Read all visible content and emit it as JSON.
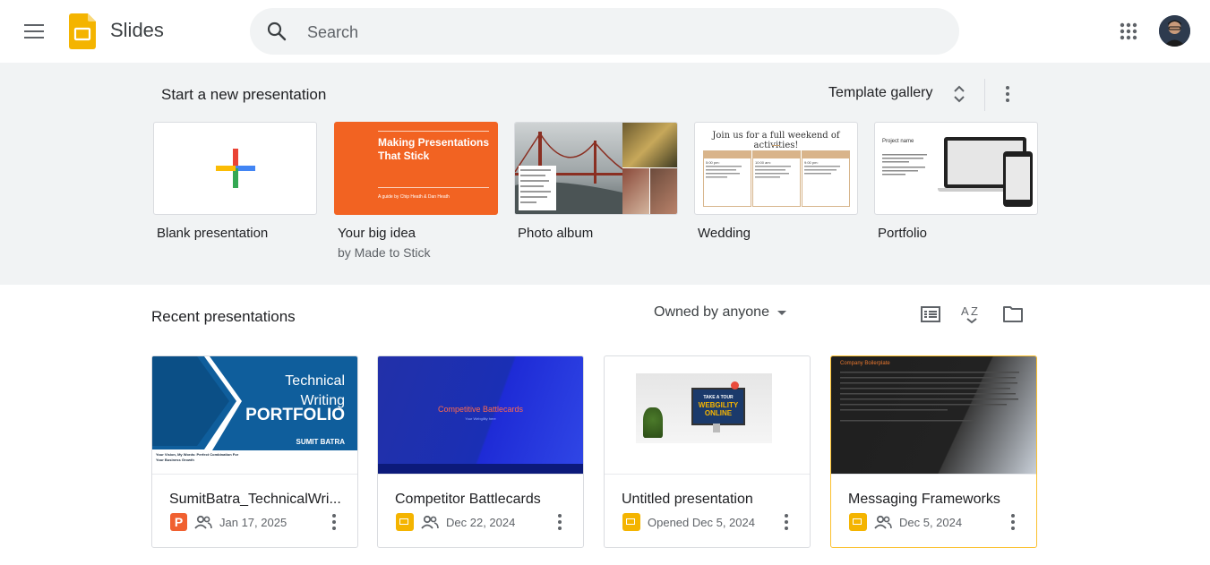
{
  "app": {
    "name": "Slides"
  },
  "search": {
    "placeholder": "Search"
  },
  "templates": {
    "heading": "Start a new presentation",
    "gallery_label": "Template gallery",
    "items": [
      {
        "name": "Blank presentation",
        "subtitle": ""
      },
      {
        "name": "Your big idea",
        "subtitle": "by Made to Stick",
        "thumb_title": "Making Presentations That Stick",
        "thumb_sub": "A guide by Chip Heath & Dan Heath"
      },
      {
        "name": "Photo album",
        "subtitle": ""
      },
      {
        "name": "Wedding",
        "subtitle": "",
        "thumb_title": "Join us for a full weekend of activities!",
        "col_heads": [
          "Thursday",
          "Friday",
          "Saturday"
        ],
        "col_times": [
          "5:00 pm: ",
          "10:00 am:",
          "9:00 pm: "
        ]
      },
      {
        "name": "Portfolio",
        "subtitle": "",
        "thumb_title": "Project name"
      }
    ]
  },
  "recent": {
    "heading": "Recent presentations",
    "owner_filter": "Owned by anyone",
    "files": [
      {
        "title": "SumitBatra_TechnicalWri...",
        "type": "pptx",
        "type_letter": "P",
        "shared": true,
        "date": "Jan 17, 2025",
        "thumb": {
          "line1": "Technical",
          "line2": "Writing",
          "line3": "PORTFOLIO",
          "author": "SUMIT BATRA",
          "tagline": "Your Vision, My Words: Perfect Combination For Your Business Growth"
        }
      },
      {
        "title": "Competitor Battlecards",
        "type": "slides",
        "shared": true,
        "date": "Dec 22, 2024",
        "thumb": {
          "title": "Competitive Battlecards",
          "sub": "Your Webgility  here"
        }
      },
      {
        "title": "Untitled presentation",
        "type": "slides",
        "shared": false,
        "date": "Opened Dec 5, 2024",
        "thumb": {
          "line1": "TAKE A TOUR",
          "line2": "WEBGILITY ONLINE"
        }
      },
      {
        "title": "Messaging Frameworks",
        "type": "slides",
        "shared": true,
        "date": "Dec 5, 2024",
        "selected": true,
        "thumb": {
          "title": "Company Boilerplate"
        }
      }
    ]
  },
  "colors": {
    "slides_yellow": "#f4b400",
    "pptx_orange": "#f06030",
    "template_bg": "#f1f3f4",
    "selected_border": "#fbc02d"
  },
  "icons": [
    "hamburger-menu-icon",
    "slides-logo-icon",
    "search-icon",
    "google-apps-icon",
    "unfold-icon",
    "more-vert-icon",
    "list-view-icon",
    "sort-az-icon",
    "folder-icon",
    "shared-people-icon"
  ]
}
